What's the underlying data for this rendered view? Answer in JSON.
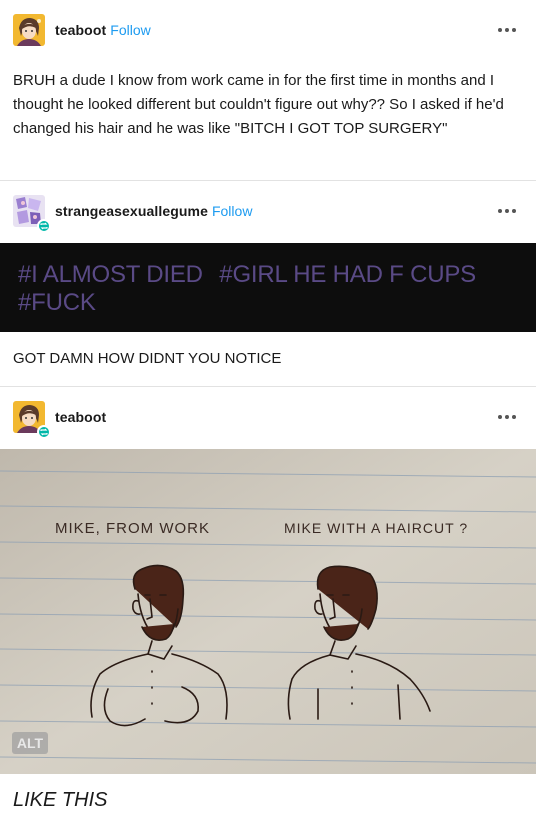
{
  "posts": [
    {
      "blog": "teaboot",
      "follow": "Follow",
      "text": "BRUH a dude I know from work came in for the first time in months and I thought he looked different but couldn't figure out why?? So I asked if he'd changed his hair and he was like \"BITCH I GOT TOP SURGERY\""
    },
    {
      "blog": "strangeasexuallegume",
      "follow": "Follow",
      "tags": [
        "#I ALMOST DIED",
        "#GIRL HE HAD F CUPS",
        "#FUCK"
      ],
      "text": "GOT DAMN HOW DIDNT YOU NOTICE"
    },
    {
      "blog": "teaboot",
      "image": {
        "label_left": "MIKE, FROM WORK",
        "label_right": "MIKE WITH A HAIRCUT ?",
        "alt": "ALT"
      },
      "caption": "LIKE THIS"
    }
  ],
  "colors": {
    "follow": "#1d9bf0",
    "tag": "#5a4a86",
    "tags_bg": "#0d0d0d",
    "reblog_badge": "#00b8a9"
  },
  "icons": {
    "more": "more-options-icon",
    "reblog": "reblog-icon"
  }
}
